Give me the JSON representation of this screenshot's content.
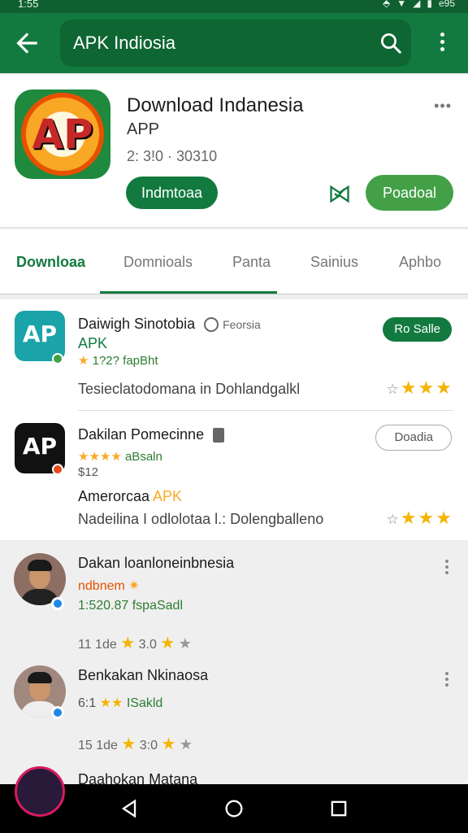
{
  "status_bar": {
    "time": "1:55",
    "battery": "e95"
  },
  "app_bar": {
    "search_text": "APK Indiosia"
  },
  "app_header": {
    "logo_text": "AP",
    "title": "Download Indanesia",
    "subtitle": "APP",
    "meta": "2: 3!0 · 30310",
    "primary_button": "Indmtoaa",
    "secondary_button": "Poadoal"
  },
  "tabs": [
    {
      "label": "Downloaa",
      "active": true
    },
    {
      "label": "Domnioals",
      "active": false
    },
    {
      "label": "Panta",
      "active": false
    },
    {
      "label": "Sainius",
      "active": false
    },
    {
      "label": "Aphbo",
      "active": false
    }
  ],
  "apps": [
    {
      "icon_text": "AP",
      "title": "Daiwigh Sinotobia",
      "tag": "Feorsia",
      "apk_label": "APK",
      "rating_text": "1?2? fapBht",
      "description": "Tesieclatodomana in Dohlandgalkl",
      "button": "Ro Salle",
      "stars": 3
    },
    {
      "icon_text": "AP",
      "title": "Dakilan Pomecinne",
      "rating_text": "aBsaln",
      "price": "$12",
      "subline_prefix": "Amerorcaa",
      "subline_apk": "APK",
      "description": "Nadeilina I odlolotaa l.: Dolengballeno",
      "button": "Doadia",
      "stars": 3
    }
  ],
  "reviews": [
    {
      "name": "Dakan loanloneinbnesia",
      "sub": "ndbnem",
      "line": "1:520.87 fspaSadl",
      "meta_prefix": "11  1de",
      "score": "3.0"
    },
    {
      "name": "Benkakan Nkinaosa",
      "sub": "6:1",
      "line": "ISakld",
      "meta_prefix": "15  1de",
      "score": "3:0"
    },
    {
      "name": "Daahokan Matana"
    }
  ],
  "colors": {
    "primary": "#137a3f",
    "accent": "#43a047",
    "star": "#f4b400"
  }
}
